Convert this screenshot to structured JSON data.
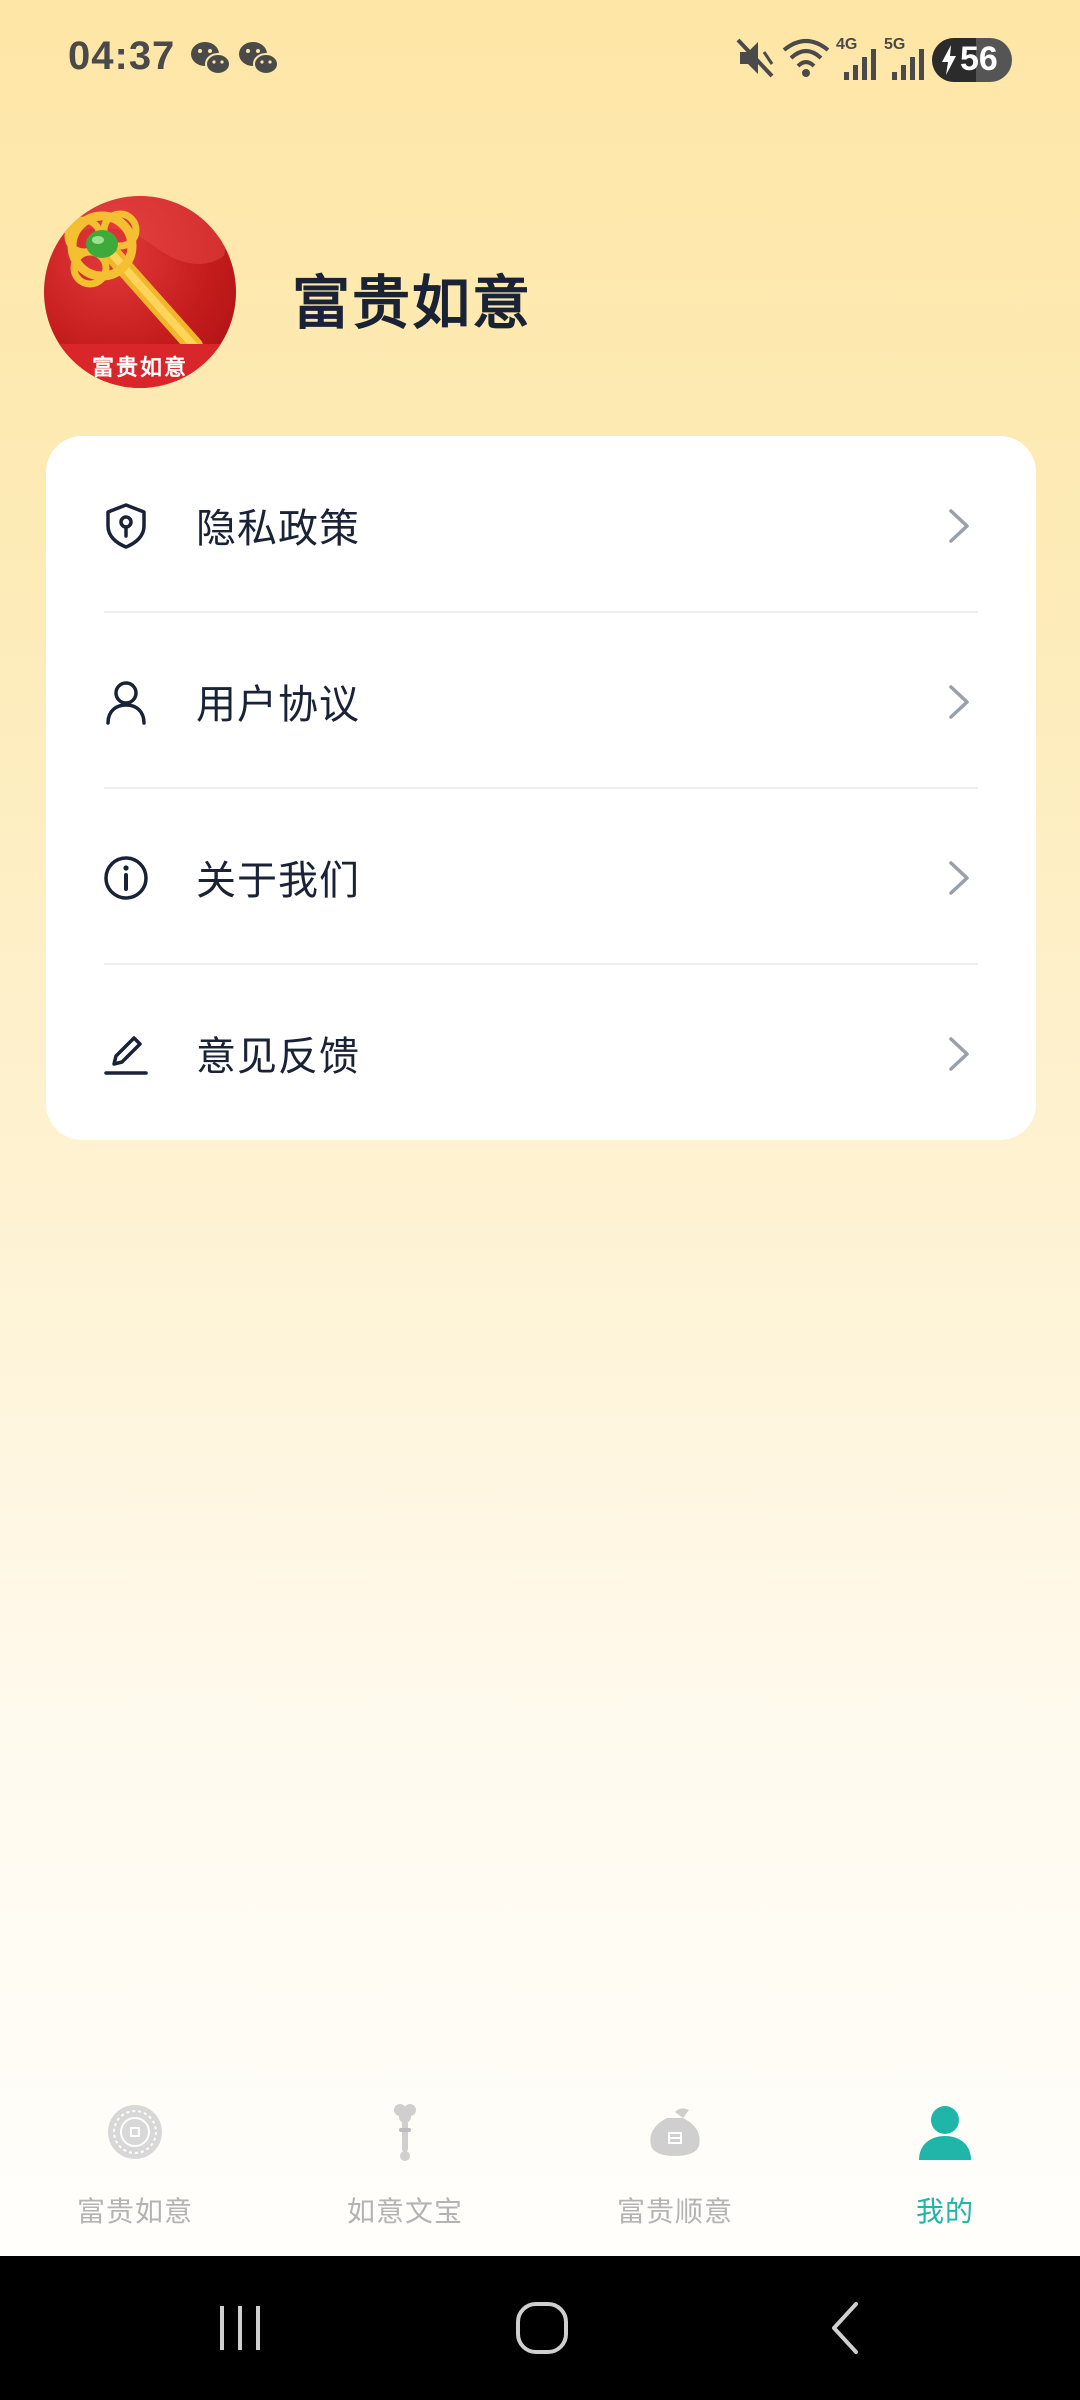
{
  "status_bar": {
    "time": "04:37",
    "battery_level": "56",
    "icons": [
      "wechat-icon",
      "wechat-icon",
      "mute-icon",
      "wifi-icon",
      "signal-4g-icon",
      "signal-5g-icon",
      "battery-charging-icon"
    ],
    "signal_4g_label": "4G",
    "signal_5g_label": "5G"
  },
  "profile": {
    "avatar_text": "富贵如意",
    "name": "富贵如意"
  },
  "menu": {
    "items": [
      {
        "label": "隐私政策",
        "icon": "shield-keyhole-icon"
      },
      {
        "label": "用户协议",
        "icon": "user-icon"
      },
      {
        "label": "关于我们",
        "icon": "info-icon"
      },
      {
        "label": "意见反馈",
        "icon": "edit-pen-icon"
      }
    ]
  },
  "tab_bar": {
    "tabs": [
      {
        "label": "富贵如意",
        "icon": "coin-icon",
        "active": false
      },
      {
        "label": "如意文宝",
        "icon": "ruyi-scepter-icon",
        "active": false
      },
      {
        "label": "富贵顺意",
        "icon": "money-bag-icon",
        "active": false
      },
      {
        "label": "我的",
        "icon": "person-icon",
        "active": true
      }
    ],
    "active_color": "#1fb5a8",
    "inactive_color": "#b3b3b3"
  },
  "nav_bar": {
    "buttons": [
      "recent-apps-icon",
      "home-icon",
      "back-icon"
    ]
  }
}
